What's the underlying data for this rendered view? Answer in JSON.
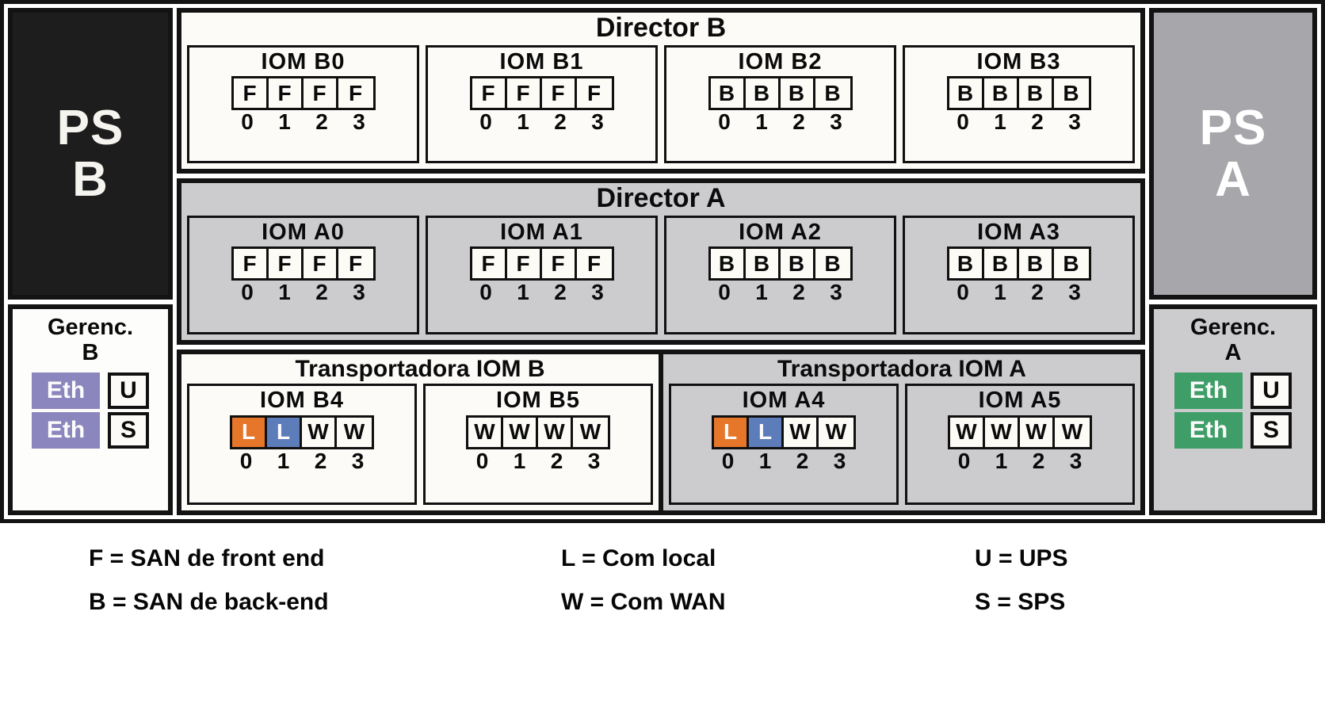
{
  "colors": {
    "frame": "#131313",
    "director_b_bg": "#fcfbf8",
    "director_a_bg": "#cccccf",
    "ps_b_bg": "#1d1d1d",
    "ps_a_bg": "#a7a7ab",
    "eth_b": "#8b86bd",
    "eth_a": "#3f9e68",
    "port_local_orange": "#e6762a",
    "port_local_blue": "#5d7cba"
  },
  "left_column": {
    "power_supply": {
      "name": "PS B",
      "line1": "PS",
      "line2": "B"
    },
    "management": {
      "title": "Gerenc.\nB",
      "eth_label_1": "Eth",
      "eth_label_2": "Eth",
      "ups_label": "U",
      "sps_label": "S"
    }
  },
  "right_column": {
    "power_supply": {
      "name": "PS A",
      "line1": "PS",
      "line2": "A"
    },
    "management": {
      "title": "Gerenc.\nA",
      "eth_label_1": "Eth",
      "eth_label_2": "Eth",
      "ups_label": "U",
      "sps_label": "S"
    }
  },
  "directors": [
    {
      "title": "Director B",
      "variant": "b",
      "ioms": [
        {
          "label": "IOM   B0",
          "ports": [
            {
              "t": "F",
              "c": "plain"
            },
            {
              "t": "F",
              "c": "plain"
            },
            {
              "t": "F",
              "c": "plain"
            },
            {
              "t": "F",
              "c": "plain"
            }
          ],
          "nums": [
            "0",
            "1",
            "2",
            "3"
          ]
        },
        {
          "label": "IOM   B1",
          "ports": [
            {
              "t": "F",
              "c": "plain"
            },
            {
              "t": "F",
              "c": "plain"
            },
            {
              "t": "F",
              "c": "plain"
            },
            {
              "t": "F",
              "c": "plain"
            }
          ],
          "nums": [
            "0",
            "1",
            "2",
            "3"
          ]
        },
        {
          "label": "IOM   B2",
          "ports": [
            {
              "t": "B",
              "c": "plain"
            },
            {
              "t": "B",
              "c": "plain"
            },
            {
              "t": "B",
              "c": "plain"
            },
            {
              "t": "B",
              "c": "plain"
            }
          ],
          "nums": [
            "0",
            "1",
            "2",
            "3"
          ]
        },
        {
          "label": "IOM   B3",
          "ports": [
            {
              "t": "B",
              "c": "plain"
            },
            {
              "t": "B",
              "c": "plain"
            },
            {
              "t": "B",
              "c": "plain"
            },
            {
              "t": "B",
              "c": "plain"
            }
          ],
          "nums": [
            "0",
            "1",
            "2",
            "3"
          ]
        }
      ]
    },
    {
      "title": "Director A",
      "variant": "a",
      "ioms": [
        {
          "label": "IOM   A0",
          "ports": [
            {
              "t": "F",
              "c": "plain"
            },
            {
              "t": "F",
              "c": "plain"
            },
            {
              "t": "F",
              "c": "plain"
            },
            {
              "t": "F",
              "c": "plain"
            }
          ],
          "nums": [
            "0",
            "1",
            "2",
            "3"
          ]
        },
        {
          "label": "IOM   A1",
          "ports": [
            {
              "t": "F",
              "c": "plain"
            },
            {
              "t": "F",
              "c": "plain"
            },
            {
              "t": "F",
              "c": "plain"
            },
            {
              "t": "F",
              "c": "plain"
            }
          ],
          "nums": [
            "0",
            "1",
            "2",
            "3"
          ]
        },
        {
          "label": "IOM   A2",
          "ports": [
            {
              "t": "B",
              "c": "plain"
            },
            {
              "t": "B",
              "c": "plain"
            },
            {
              "t": "B",
              "c": "plain"
            },
            {
              "t": "B",
              "c": "plain"
            }
          ],
          "nums": [
            "0",
            "1",
            "2",
            "3"
          ]
        },
        {
          "label": "IOM   A3",
          "ports": [
            {
              "t": "B",
              "c": "plain"
            },
            {
              "t": "B",
              "c": "plain"
            },
            {
              "t": "B",
              "c": "plain"
            },
            {
              "t": "B",
              "c": "plain"
            }
          ],
          "nums": [
            "0",
            "1",
            "2",
            "3"
          ]
        }
      ]
    }
  ],
  "carriers": [
    {
      "title": "Transportadora IOM B",
      "variant": "b",
      "ioms": [
        {
          "label": "IOM   B4",
          "ports": [
            {
              "t": "L",
              "c": "orange"
            },
            {
              "t": "L",
              "c": "blue"
            },
            {
              "t": "W",
              "c": "plain"
            },
            {
              "t": "W",
              "c": "plain"
            }
          ],
          "nums": [
            "0",
            "1",
            "2",
            "3"
          ]
        },
        {
          "label": "IOM   B5",
          "ports": [
            {
              "t": "W",
              "c": "plain"
            },
            {
              "t": "W",
              "c": "plain"
            },
            {
              "t": "W",
              "c": "plain"
            },
            {
              "t": "W",
              "c": "plain"
            }
          ],
          "nums": [
            "0",
            "1",
            "2",
            "3"
          ]
        }
      ]
    },
    {
      "title": "Transportadora IOM A",
      "variant": "a",
      "ioms": [
        {
          "label": "IOM   A4",
          "ports": [
            {
              "t": "L",
              "c": "orange"
            },
            {
              "t": "L",
              "c": "blue"
            },
            {
              "t": "W",
              "c": "plain"
            },
            {
              "t": "W",
              "c": "plain"
            }
          ],
          "nums": [
            "0",
            "1",
            "2",
            "3"
          ]
        },
        {
          "label": "IOM   A5",
          "ports": [
            {
              "t": "W",
              "c": "plain"
            },
            {
              "t": "W",
              "c": "plain"
            },
            {
              "t": "W",
              "c": "plain"
            },
            {
              "t": "W",
              "c": "plain"
            }
          ],
          "nums": [
            "0",
            "1",
            "2",
            "3"
          ]
        }
      ]
    }
  ],
  "legend": {
    "column_1": [
      "F = SAN de front end",
      "B = SAN de back-end"
    ],
    "column_2": [
      "L = Com local",
      "W = Com WAN"
    ],
    "column_3": [
      "U = UPS",
      "S = SPS"
    ]
  }
}
